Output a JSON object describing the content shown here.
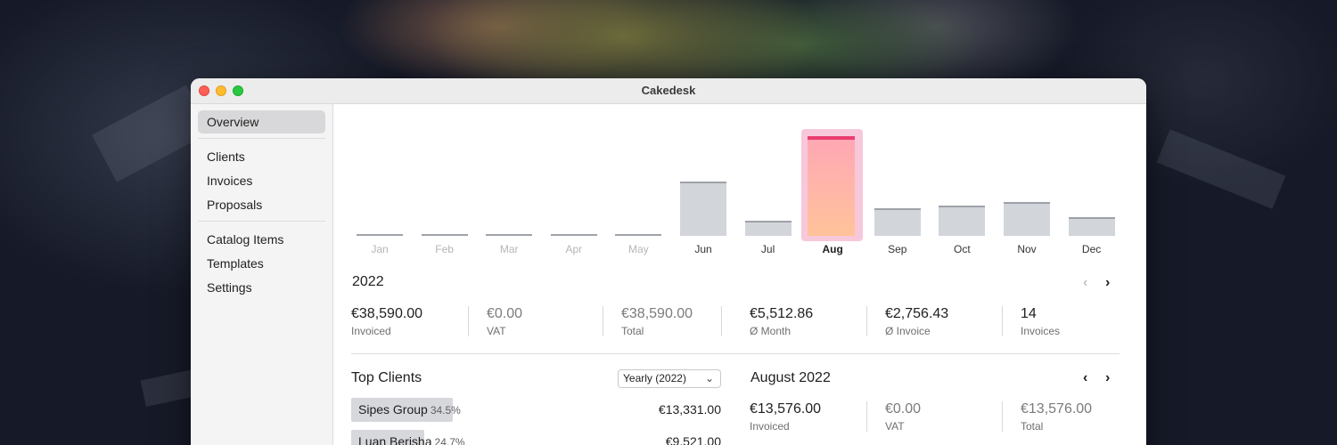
{
  "window": {
    "title": "Cakedesk"
  },
  "sidebar": {
    "items": [
      {
        "label": "Overview",
        "active": true
      },
      {
        "label": "Clients"
      },
      {
        "label": "Invoices"
      },
      {
        "label": "Proposals"
      },
      {
        "label": "Catalog Items"
      },
      {
        "label": "Templates"
      },
      {
        "label": "Settings"
      }
    ]
  },
  "chart_data": {
    "type": "bar",
    "categories": [
      "Jan",
      "Feb",
      "Mar",
      "Apr",
      "May",
      "Jun",
      "Jul",
      "Aug",
      "Sep",
      "Oct",
      "Nov",
      "Dec"
    ],
    "values": [
      0,
      0,
      0,
      0,
      0,
      7400,
      2100,
      13576,
      3700,
      4100,
      4600,
      2500
    ],
    "highlighted": "Aug",
    "title": "",
    "xlabel": "",
    "ylabel": "",
    "ylim": [
      0,
      13576
    ],
    "grid": false,
    "colors": {
      "bar": "#d2d5da",
      "bar_top": "#9ea2a8",
      "highlight_top": "#ea3c6f",
      "highlight_fill": "#ffb3ad",
      "highlight_bg": "#f7c7da"
    }
  },
  "year_summary": {
    "title": "2022",
    "stats": [
      {
        "value": "€38,590.00",
        "label": "Invoiced"
      },
      {
        "value": "€0.00",
        "label": "VAT",
        "muted": true
      },
      {
        "value": "€38,590.00",
        "label": "Total",
        "muted": true
      },
      {
        "value": "€5,512.86",
        "label": "Ø Month"
      },
      {
        "value": "€2,756.43",
        "label": "Ø Invoice"
      },
      {
        "value": "14",
        "label": "Invoices"
      }
    ]
  },
  "top_clients": {
    "title": "Top Clients",
    "period": "Yearly (2022)",
    "clients": [
      {
        "name": "Sipes Group",
        "percent": "34.5%",
        "share": 34.5,
        "amount": "€13,331.00"
      },
      {
        "name": "Luan Berisha",
        "percent": "24.7%",
        "share": 24.7,
        "amount": "€9,521.00"
      }
    ]
  },
  "month_summary": {
    "title": "August 2022",
    "stats": [
      {
        "value": "€13,576.00",
        "label": "Invoiced"
      },
      {
        "value": "€0.00",
        "label": "VAT",
        "muted": true
      },
      {
        "value": "€13,576.00",
        "label": "Total",
        "muted": true
      }
    ]
  },
  "icons": {
    "prev": "‹",
    "next": "›",
    "dropdown": "⌄"
  }
}
